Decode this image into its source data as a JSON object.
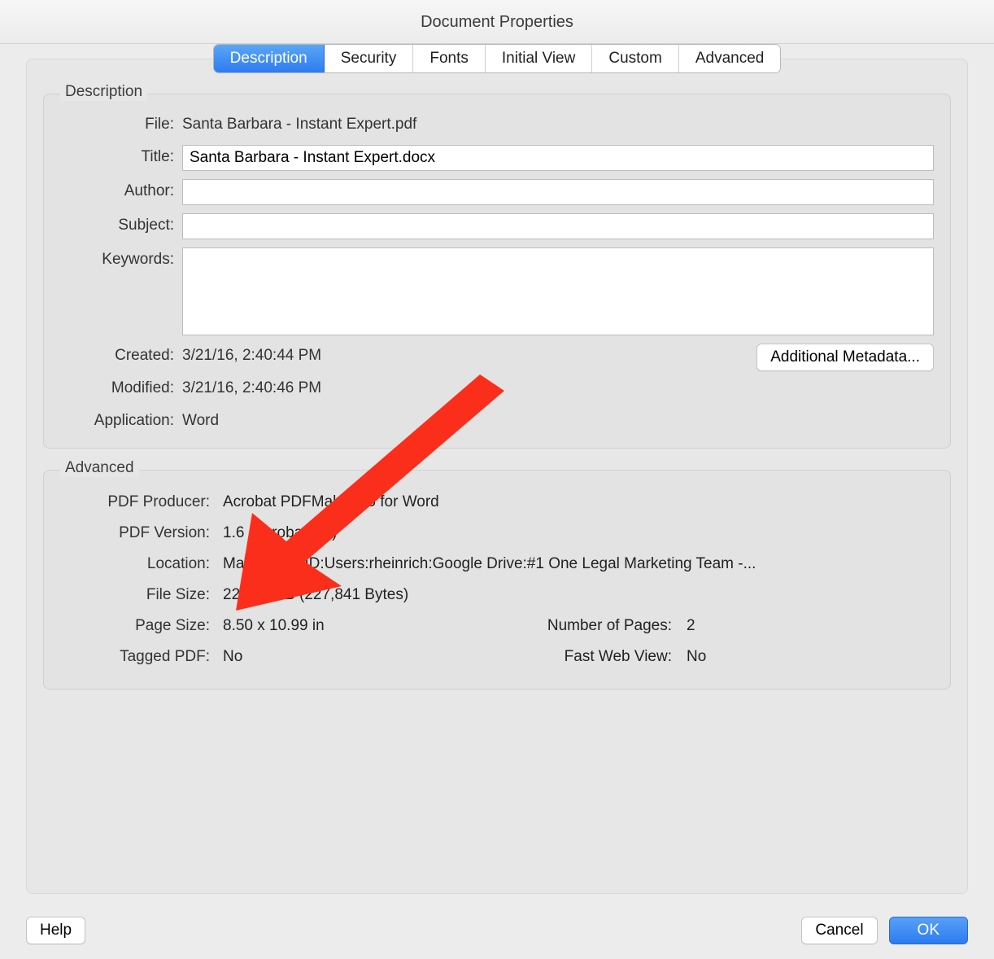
{
  "window": {
    "title": "Document Properties"
  },
  "tabs": {
    "items": [
      "Description",
      "Security",
      "Fonts",
      "Initial View",
      "Custom",
      "Advanced"
    ],
    "active": "Description"
  },
  "description": {
    "section_title": "Description",
    "labels": {
      "file": "File:",
      "title": "Title:",
      "author": "Author:",
      "subject": "Subject:",
      "keywords": "Keywords:",
      "created": "Created:",
      "modified": "Modified:",
      "application": "Application:"
    },
    "file": "Santa Barbara - Instant Expert.pdf",
    "title": "Santa Barbara - Instant Expert.docx",
    "author": "",
    "subject": "",
    "keywords": "",
    "created": "3/21/16, 2:40:44 PM",
    "modified": "3/21/16, 2:40:46 PM",
    "application": "Word",
    "additional_metadata_btn": "Additional Metadata..."
  },
  "advanced": {
    "section_title": "Advanced",
    "labels": {
      "producer": "PDF Producer:",
      "version": "PDF Version:",
      "location": "Location:",
      "filesize": "File Size:",
      "pagesize": "Page Size:",
      "numpages": "Number of Pages:",
      "tagged": "Tagged PDF:",
      "fastweb": "Fast Web View:"
    },
    "producer": "Acrobat PDFMaker 15 for Word",
    "version": "1.6 (Acrobat 7.x)",
    "location": "Macintosh HD:Users:rheinrich:Google Drive:#1 One Legal Marketing Team -...",
    "filesize": "222.50 KB (227,841 Bytes)",
    "pagesize": "8.50 x 10.99 in",
    "numpages": "2",
    "tagged": "No",
    "fastweb": "No"
  },
  "footer": {
    "help": "Help",
    "cancel": "Cancel",
    "ok": "OK"
  }
}
